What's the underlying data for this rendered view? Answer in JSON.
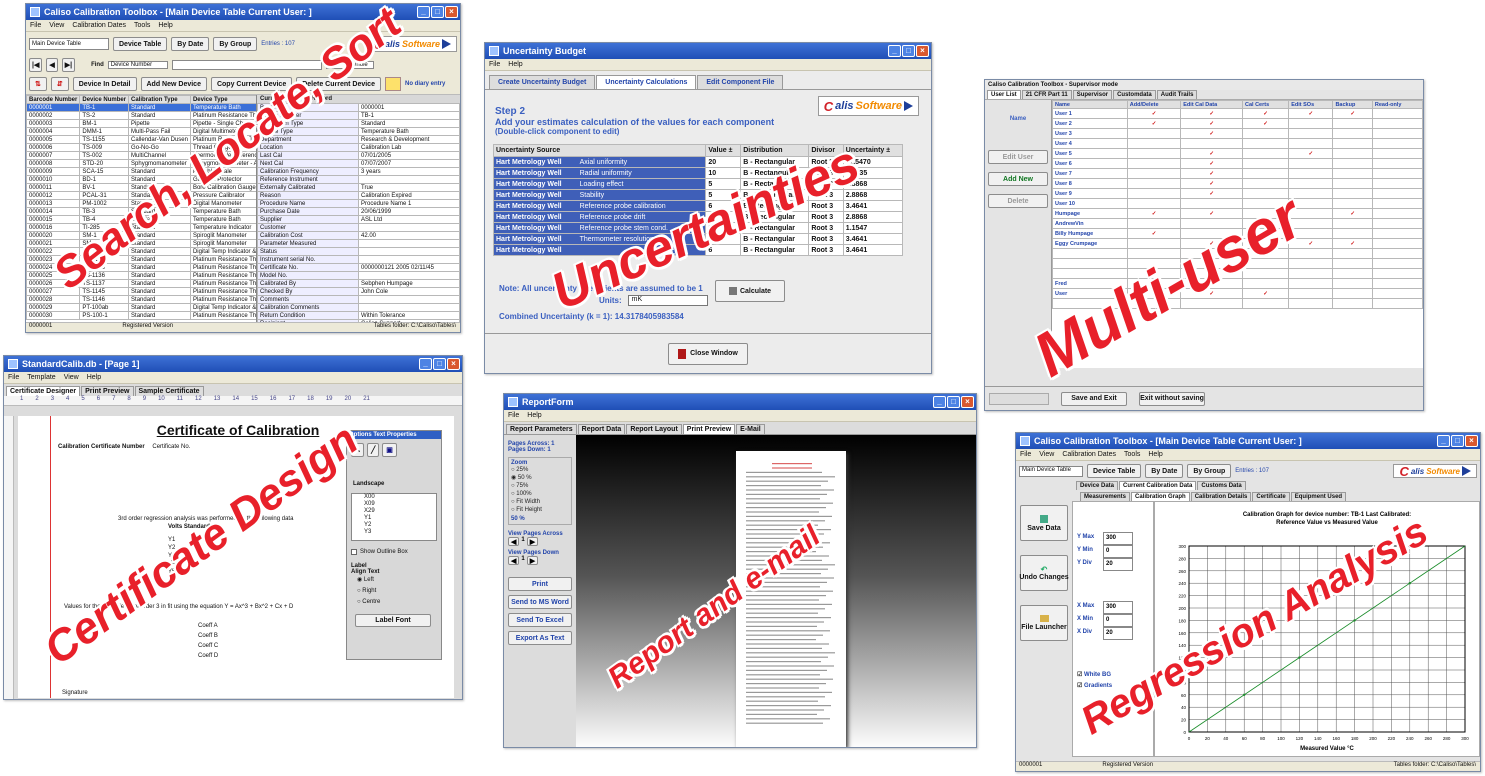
{
  "overlays": {
    "search": "Search, Locate, Sort",
    "uncertainties": "Uncertainties",
    "multiuser": "Multi-user",
    "certificate": "Certificate Design",
    "report": "Report and e-mail",
    "regression": "Regression Analysis"
  },
  "brand": {
    "c": "C",
    "alis": "alis",
    "o": "o",
    "software": "Software"
  },
  "win1": {
    "title": "Caliso Calibration Toolbox - [Main Device Table  Current User: ]",
    "menu": [
      "File",
      "View",
      "Calibration Dates",
      "Tools",
      "Help"
    ],
    "table_select": "Main Device Table",
    "nav_buttons": [
      "Device Table",
      "By Date",
      "By Group"
    ],
    "entries": "Entries : 107",
    "find_label": "Find",
    "find_field": "Device Number",
    "find_mode": "Find",
    "whole": "Whole",
    "action_buttons": [
      "Device In Detail",
      "Add New Device",
      "Copy Current Device",
      "Delete Current Device"
    ],
    "no_diary": "No diary entry",
    "columns": [
      "Barcode Number",
      "Device Number",
      "Calibration Type",
      "Device Type",
      "Department"
    ],
    "rows": [
      [
        "0000001",
        "TB-1",
        "Standard",
        "Temperature Bath",
        "Research & Developm"
      ],
      [
        "0000002",
        "TS-2",
        "Standard",
        "Platinum Resistance Thermometer",
        "Research & Developm"
      ],
      [
        "0000003",
        "BM-1",
        "Pipette",
        "Pipette - Single Channel",
        "Research & Developm"
      ],
      [
        "0000004",
        "DMM-1",
        "Multi-Pass Fail",
        "Digital Multimeter",
        "Research & Developm"
      ],
      [
        "0000005",
        "TS-1155",
        "Callendar-Van Dusen",
        "Platinum Resistance Thermometer",
        "Controls"
      ],
      [
        "0000006",
        "TS-009",
        "Go-No-Go",
        "Thread Gauge M50",
        "Controls"
      ],
      [
        "0000007",
        "TS-002",
        "MultiChannel",
        "Thermocouple Reference Unit",
        "Research & Developm"
      ],
      [
        "0000008",
        "STD-20",
        "Sphygmomanometer",
        "Sphygmomanometer - Aneroid",
        "Research & Developm"
      ],
      [
        "0000009",
        "SCA-15",
        "Standard",
        "Portable Scale",
        "Research & Developm"
      ],
      [
        "0000010",
        "BD-1",
        "Standard",
        "Gas Ball Protector",
        "Controls"
      ],
      [
        "0000011",
        "BV-1",
        "Standard",
        "Bore Calibration Gauge",
        "Controls"
      ],
      [
        "0000012",
        "PCAL-31",
        "Standard",
        "Pressure Calibrator",
        "Controls"
      ],
      [
        "0000013",
        "PM-1002",
        "Standard",
        "Digital Manometer",
        "Controls"
      ],
      [
        "0000014",
        "TB-3",
        "Standard",
        "Temperature Bath",
        "Controls"
      ],
      [
        "0000015",
        "TB-4",
        "Standard",
        "Temperature Bath",
        "Controls"
      ],
      [
        "0000016",
        "TI-285",
        "Standard",
        "Temperature Indicator",
        "Controls"
      ],
      [
        "0000020",
        "SM-1",
        "Standard",
        "Spiroglit Manometer",
        "Customer Services"
      ],
      [
        "0000021",
        "SM-2",
        "Standard",
        "Spiroglit Manometer",
        "Controls"
      ],
      [
        "0000022",
        "PT-100",
        "Standard",
        "Digital Temp Indicator & 6 PRT's",
        "Research & Developm"
      ],
      [
        "0000023",
        "TS-1134",
        "Standard",
        "Platinum Resistance Thermometer",
        "Research & Developm"
      ],
      [
        "0000024",
        "TS-1135",
        "Standard",
        "Platinum Resistance Thermometer",
        "Research & Developm"
      ],
      [
        "0000025",
        "TS-1136",
        "Standard",
        "Platinum Resistance Thermometer",
        "Research & Developm"
      ],
      [
        "0000026",
        "TS-1137",
        "Standard",
        "Platinum Resistance Thermometer",
        "Research & Developm"
      ],
      [
        "0000027",
        "TS-1145",
        "Standard",
        "Platinum Resistance Thermometer",
        "Research & Developm"
      ],
      [
        "0000028",
        "TS-1146",
        "Standard",
        "Platinum Resistance Thermometer",
        "Research & Developm"
      ],
      [
        "0000029",
        "PT-100ab",
        "Standard",
        "Digital Temp Indicator & 6 PRT's",
        "Controls"
      ],
      [
        "0000030",
        "PS-100-1",
        "Standard",
        "Platinum Resistance Thermometer",
        "Controls"
      ]
    ],
    "record_title": "Current Correlate Record",
    "record": [
      [
        "Barcode",
        "0000001"
      ],
      [
        "Device Number",
        "TB-1"
      ],
      [
        "Calibration Type",
        "Standard"
      ],
      [
        "Device Type",
        "Temperature Bath"
      ],
      [
        "Department",
        "Research & Development"
      ],
      [
        "Location",
        "Calibration Lab"
      ],
      [
        "Last Cal",
        "07/01/2005"
      ],
      [
        "Next Cal",
        "07/07/2007"
      ],
      [
        "Calibration Frequency",
        "3 years"
      ],
      [
        "Reference Instrument",
        ""
      ],
      [
        "Externally Calibrated",
        "True"
      ],
      [
        "Reason",
        "Calibration Expired"
      ],
      [
        "Procedure Name",
        "Procedure Name 1"
      ],
      [
        "Purchase Date",
        "20/06/1999"
      ],
      [
        "Supplier",
        "ASL Ltd"
      ],
      [
        "Customer",
        ""
      ],
      [
        "Calibration Cost",
        "42.00"
      ],
      [
        "Parameter Measured",
        ""
      ],
      [
        "Status",
        ""
      ],
      [
        "Instrument serial No.",
        ""
      ],
      [
        "Certificate No.",
        "0000000121 2005 02/11/45"
      ],
      [
        "Model No.",
        ""
      ],
      [
        "Calibrated By",
        "Sebphen Humpage"
      ],
      [
        "Checked By",
        "John Cole"
      ],
      [
        "Comments",
        ""
      ],
      [
        "Calibration Comments",
        ""
      ],
      [
        "Return Condition",
        "Within Tolerance"
      ],
      [
        "Recipient",
        "Caliso Support"
      ],
      [
        "Entered By",
        "Jean Hamer-cross BL-HAK"
      ]
    ],
    "status_left": "0000001",
    "status_mid": "Registered Version",
    "status_right": "Tables folder: C:\\Caliso\\Tables\\"
  },
  "win2": {
    "title": "Uncertainty Budget",
    "menu": [
      "File",
      "Help"
    ],
    "tabs": [
      "Create Uncertainty Budget",
      "Uncertainty Calculations",
      "Edit Component File"
    ],
    "step": "Step 2",
    "instructions": [
      "Add your estimates calculation of the values for each component",
      "(Double-click component to edit)"
    ],
    "columns": [
      "Uncertainty Source",
      "Value ±",
      "Distribution",
      "Divisor",
      "Uncertainty ±"
    ],
    "rows": [
      [
        "Hart Metrology Well",
        "20",
        "B - Rectangular",
        "Root 3",
        "11.5470"
      ],
      [
        "Hart Metrology Well",
        "10",
        "B - Rectangular",
        "Root 3",
        "5.7735"
      ],
      [
        "Hart Metrology Well",
        "5",
        "B - Rectangular",
        "Root 3",
        "2.8868"
      ],
      [
        "Hart Metrology Well",
        "5",
        "B - Rectangular",
        "Root 3",
        "2.8868"
      ],
      [
        "Hart Metrology Well",
        "6",
        "B - Rectangular",
        "Root 3",
        "3.4641"
      ],
      [
        "Hart Metrology Well",
        "5",
        "B - Rectangular",
        "Root 3",
        "2.8868"
      ],
      [
        "Hart Metrology Well",
        "2",
        "B - Rectangular",
        "Root 3",
        "1.1547"
      ],
      [
        "Hart Metrology Well",
        "6",
        "B - Rectangular",
        "Root 3",
        "3.4641"
      ],
      [
        "Hart Metrology Well",
        "6",
        "B - Rectangular",
        "Root 3",
        "3.4641"
      ]
    ],
    "sources": [
      "Axial uniformity",
      "Radial uniformity",
      "Loading effect",
      "Stability",
      "Reference probe calibration",
      "Reference probe drift",
      "Reference probe stem cond.",
      "Thermometer resolution",
      ""
    ],
    "note": "Note: All uncertainty coefficients are assumed to be 1",
    "units_label": "Units:",
    "units_value": "mK",
    "calculate": "Calculate",
    "combined": "Combined Uncertainty (k = 1): 14.3178405983584",
    "close": "Close Window"
  },
  "win3": {
    "title": "Caliso Calibration Toolbox - Supervisor mode",
    "tabs": [
      "User List",
      "21 CFR Part 11",
      "Supervisor",
      "Customdata",
      "Audit Trails"
    ],
    "name_label": "Name",
    "columns": [
      "Name",
      "Add/Delete",
      "Edit Cal Data",
      "Cal Certs",
      "Edit SOs",
      "Backup",
      "Read-only"
    ],
    "users": [
      "User 1",
      "User 2",
      "User 3",
      "User 4",
      "User 5",
      "User 6",
      "User 7",
      "User 8",
      "User 9",
      "User 10",
      "Humpage",
      "AndrewVin",
      "Billy Humpage",
      "Eggy Crumpage",
      "",
      "",
      "",
      "Fred",
      "User",
      ""
    ],
    "checks": [
      [
        1,
        1,
        1,
        1,
        1,
        0
      ],
      [
        1,
        1,
        1,
        0,
        0,
        0
      ],
      [
        0,
        1,
        0,
        0,
        0,
        0
      ],
      [
        0,
        0,
        0,
        0,
        0,
        0
      ],
      [
        0,
        1,
        0,
        1,
        0,
        0
      ],
      [
        0,
        1,
        0,
        0,
        0,
        0
      ],
      [
        0,
        1,
        0,
        0,
        0,
        0
      ],
      [
        0,
        1,
        0,
        0,
        0,
        0
      ],
      [
        0,
        1,
        0,
        0,
        0,
        0
      ],
      [
        0,
        0,
        0,
        0,
        0,
        0
      ],
      [
        1,
        1,
        0,
        0,
        1,
        0
      ],
      [
        0,
        0,
        0,
        0,
        0,
        0
      ],
      [
        1,
        0,
        0,
        0,
        0,
        0
      ],
      [
        0,
        1,
        0,
        1,
        1,
        0
      ],
      [
        0,
        0,
        0,
        0,
        0,
        0
      ],
      [
        0,
        0,
        0,
        0,
        0,
        0
      ],
      [
        0,
        0,
        0,
        0,
        0,
        0
      ],
      [
        1,
        1,
        0,
        0,
        0,
        0
      ],
      [
        0,
        1,
        1,
        0,
        0,
        0
      ],
      [
        0,
        0,
        0,
        0,
        0,
        0
      ]
    ],
    "side_buttons": [
      "Edit User",
      "Add New",
      "Delete"
    ],
    "save": "Save and Exit",
    "exit": "Exit without saving"
  },
  "win4": {
    "title": "StandardCalib.db - [Page 1]",
    "menu": [
      "File",
      "Template",
      "View",
      "Help"
    ],
    "tabs": [
      "Certificate Designer",
      "Print Preview",
      "Sample Certificate"
    ],
    "heading": "Certificate of Calibration",
    "cert_no_label": "Calibration Certificate Number",
    "cert_no_value": "Certificate No.",
    "regression_text": "3rd order regression analysis was performed on the following data",
    "volts": "Volts  Standard",
    "ylist": [
      "Y1",
      "Y2",
      "Y3",
      "Y4",
      "Y5",
      "Y6"
    ],
    "equation": "Values for the coefficients of order 3 in fit using the equation  Y = Ax^3 + Bx^2 + Cx + D",
    "coeffs": [
      "Coeff A",
      "Coeff B",
      "Coeff C",
      "Coeff D"
    ],
    "signature": "Signature",
    "panel_title": "Options Text Properties",
    "landscape": "Landscape",
    "fields": [
      "X00",
      "X09",
      "X29",
      "Y1",
      "Y2",
      "Y3"
    ],
    "outline": "Show Outline Box",
    "label_hdr": "Label",
    "align": "Align Text",
    "aligns": [
      "Left",
      "Right",
      "Centre"
    ],
    "label_font": "Label Font",
    "ruler": [
      "1",
      "2",
      "3",
      "4",
      "5",
      "6",
      "7",
      "8",
      "9",
      "10",
      "11",
      "12",
      "13",
      "14",
      "15",
      "16",
      "17",
      "18",
      "19",
      "20",
      "21"
    ]
  },
  "win5": {
    "title": "ReportForm",
    "menu": [
      "File",
      "Help"
    ],
    "tabs": [
      "Report Parameters",
      "Report Data",
      "Report Layout",
      "Print Preview",
      "E-Mail"
    ],
    "pages_across": "Pages Across:  1",
    "pages_down": "Pages Down:  1",
    "zoom_label": "Zoom",
    "zoom_opts": [
      "25%",
      "50 %",
      "75%",
      "100%",
      "Fit Width",
      "Fit Height"
    ],
    "zoom_pct": "50 %",
    "view_across": "View Pages Across",
    "view_down": "View Pages Down",
    "buttons": [
      "Print",
      "Send to MS Word",
      "Send To Excel",
      "Export As Text"
    ]
  },
  "win6": {
    "title": "Caliso Calibration Toolbox - [Main Device Table  Current User: ]",
    "menu": [
      "File",
      "View",
      "Calibration Dates",
      "Tools",
      "Help"
    ],
    "table_select": "Main Device Table",
    "nav_buttons": [
      "Device Table",
      "By Date",
      "By Group"
    ],
    "entries": "Entries : 107",
    "tabs1": [
      "Device Data",
      "Current Calibration Data",
      "Customs Data"
    ],
    "tabs2": [
      "Measurements",
      "Calibration Graph",
      "Calibration Details",
      "Certificate",
      "Equipment Used"
    ],
    "side_buttons": [
      "Save Data",
      "Undo Changes",
      "File Launcher"
    ],
    "ymax_label": "Y Max",
    "ymax": "300",
    "ymin_label": "Y Min",
    "ymin": "0",
    "ydiv_label": "Y Div",
    "ydiv": "20",
    "xmax_label": "X Max",
    "xmax": "300",
    "xmin_label": "X Min",
    "xmin": "0",
    "xdiv_label": "X Div",
    "xdiv": "20",
    "white_bg": "White BG",
    "gradient": "Gradients",
    "status_left": "0000001",
    "status_mid": "Registered Version",
    "status_right": "Tables folder: C:\\Caliso\\Tables\\"
  },
  "chart_data": {
    "type": "line",
    "title": "Calibration Graph for device number: TB-1 Last Calibrated:",
    "subtitle": "Reference Value  vs  Measured Value",
    "xlabel": "Measured Value °C",
    "ylabel": "",
    "xlim": [
      0,
      300
    ],
    "ylim": [
      0,
      300
    ],
    "grid": true,
    "x_ticks": [
      "0",
      "20",
      "40",
      "60",
      "80",
      "100",
      "120",
      "140",
      "160",
      "180",
      "200",
      "220",
      "240",
      "260",
      "280",
      "300"
    ],
    "y_ticks": [
      "0",
      "20",
      "40",
      "60",
      "80",
      "100",
      "120",
      "140",
      "160",
      "180",
      "200",
      "220",
      "240",
      "260",
      "280",
      "300"
    ],
    "series": [
      {
        "x": [
          0,
          50,
          100,
          150,
          200,
          250,
          300
        ],
        "y": [
          0,
          50,
          100,
          150,
          200,
          250,
          300
        ]
      }
    ],
    "points": [
      {
        "x": 60,
        "y": 60
      },
      {
        "x": 120,
        "y": 120
      },
      {
        "x": 180,
        "y": 180
      },
      {
        "x": 240,
        "y": 240
      }
    ],
    "line_color": "#1a8c2a"
  }
}
